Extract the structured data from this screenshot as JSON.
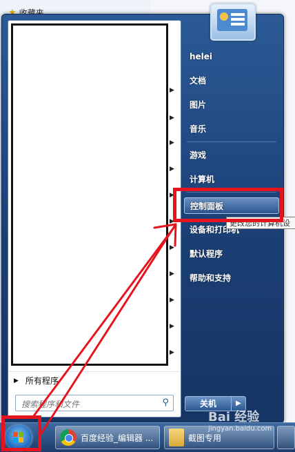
{
  "background": {
    "favorites_label": "收藏夹"
  },
  "start_menu": {
    "all_programs": "所有程序",
    "search_placeholder": "搜索程序和文件",
    "user_name": "helei",
    "items": [
      {
        "label": "文档"
      },
      {
        "label": "图片"
      },
      {
        "label": "音乐"
      },
      {
        "label": "游戏"
      },
      {
        "label": "计算机"
      },
      {
        "label": "控制面板"
      },
      {
        "label": "设备和打印机"
      },
      {
        "label": "默认程序"
      },
      {
        "label": "帮助和支持"
      }
    ],
    "tooltip": "更改您的计算机设",
    "shutdown_label": "关机"
  },
  "taskbar": {
    "buttons": [
      {
        "label": "百度经验_编辑器 ..."
      },
      {
        "label": "截图专用"
      }
    ]
  },
  "watermark": {
    "text": "Bai 经验",
    "url": "jingyan.baidu.com"
  },
  "colors": {
    "annotation_red": "#e5141e",
    "menu_blue": "#1b3f75"
  },
  "icons": {
    "favorites": "star-icon",
    "search": "search-icon",
    "start": "windows-flag-icon",
    "browser": "chrome-icon",
    "folder": "folder-icon"
  }
}
